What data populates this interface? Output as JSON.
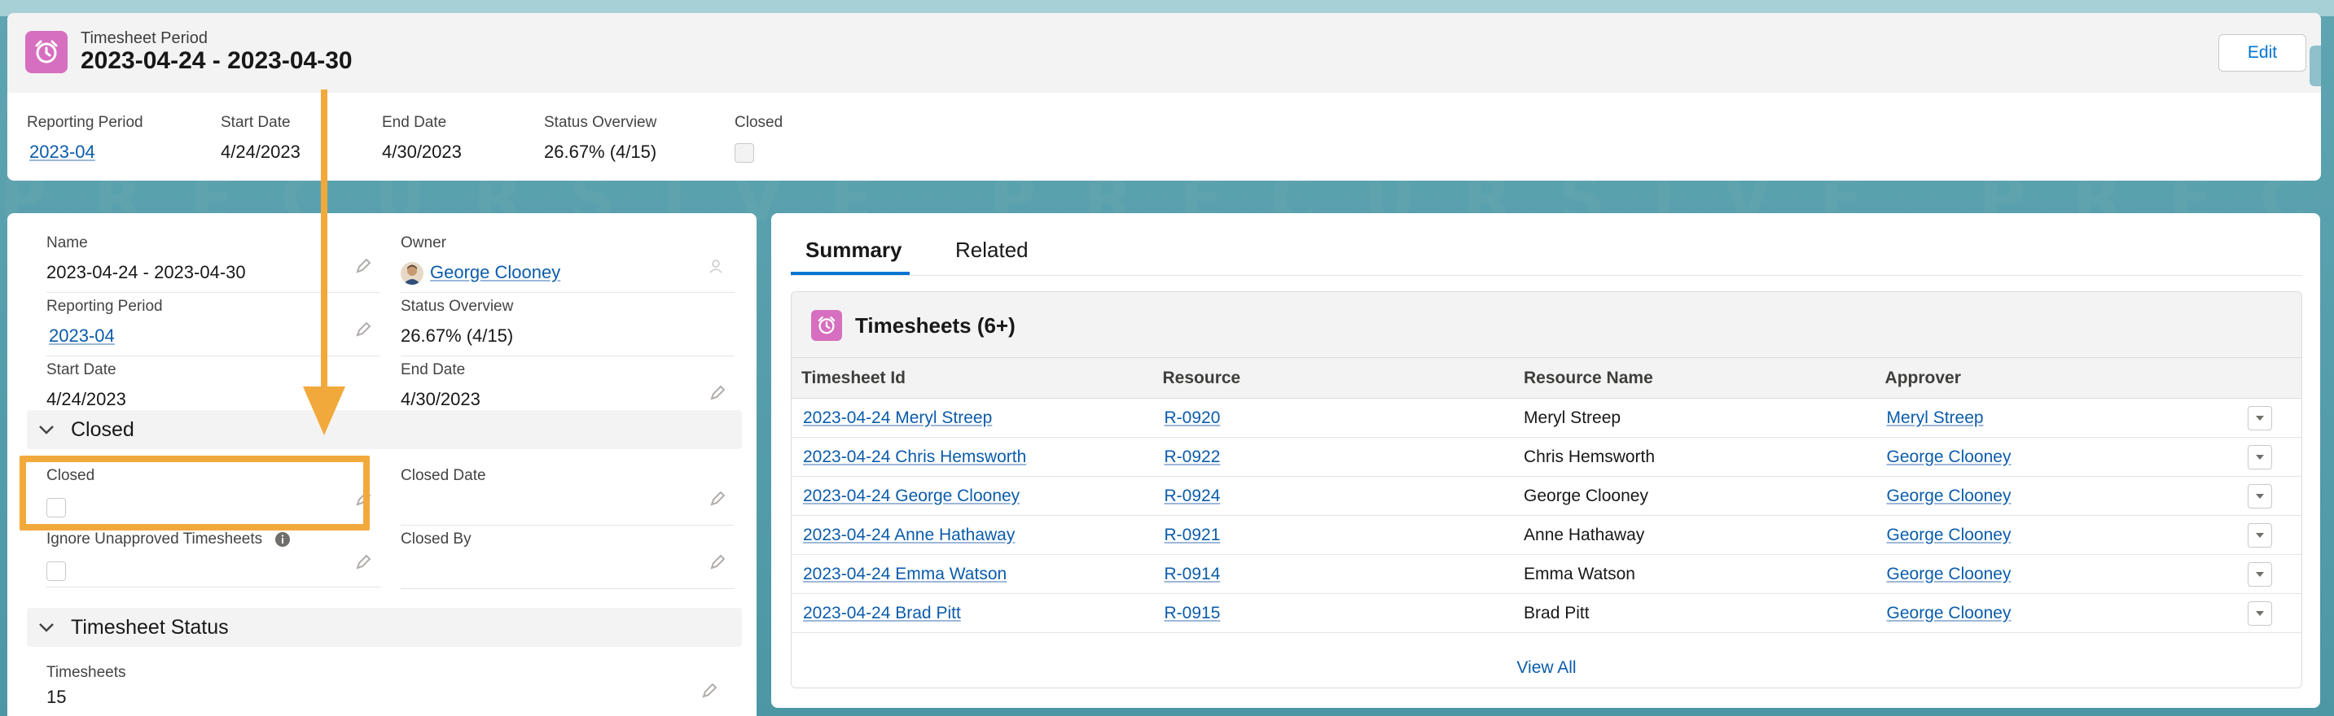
{
  "header": {
    "object_label": "Timesheet Period",
    "title": "2023-04-24 - 2023-04-30",
    "edit_label": "Edit",
    "highlights": [
      {
        "label": "Reporting Period",
        "value": "2023-04"
      },
      {
        "label": "Start Date",
        "value": "4/24/2023"
      },
      {
        "label": "End Date",
        "value": "4/30/2023"
      },
      {
        "label": "Status Overview",
        "value": "26.67% (4/15)"
      },
      {
        "label": "Closed",
        "value": ""
      }
    ]
  },
  "watermark": "PRECURSIVE PRECURSIVE PRECURSIVE",
  "details": {
    "name_label": "Name",
    "name_value": "2023-04-24 - 2023-04-30",
    "owner_label": "Owner",
    "owner_value": "George Clooney",
    "reporting_period_label": "Reporting Period",
    "reporting_period_value": "2023-04",
    "status_overview_label": "Status Overview",
    "status_overview_value": "26.67% (4/15)",
    "start_date_label": "Start Date",
    "start_date_value": "4/24/2023",
    "end_date_label": "End Date",
    "end_date_value": "4/30/2023",
    "closed_section": "Closed",
    "closed_label": "Closed",
    "closed_date_label": "Closed Date",
    "ignore_unapproved_label": "Ignore Unapproved Timesheets",
    "closed_by_label": "Closed By",
    "timesheet_status_section": "Timesheet Status",
    "timesheets_label": "Timesheets",
    "timesheets_value": "15"
  },
  "tabs": {
    "summary": "Summary",
    "related": "Related"
  },
  "related": {
    "title": "Timesheets (6+)",
    "columns": [
      "Timesheet Id",
      "Resource",
      "Resource Name",
      "Approver"
    ],
    "rows": [
      {
        "id": "2023-04-24 Meryl Streep",
        "resource": "R-0920",
        "name": "Meryl Streep",
        "approver": "Meryl Streep"
      },
      {
        "id": "2023-04-24 Chris Hemsworth",
        "resource": "R-0922",
        "name": "Chris Hemsworth",
        "approver": "George Clooney"
      },
      {
        "id": "2023-04-24 George Clooney",
        "resource": "R-0924",
        "name": "George Clooney",
        "approver": "George Clooney"
      },
      {
        "id": "2023-04-24 Anne Hathaway",
        "resource": "R-0921",
        "name": "Anne Hathaway",
        "approver": "George Clooney"
      },
      {
        "id": "2023-04-24 Emma Watson",
        "resource": "R-0914",
        "name": "Emma Watson",
        "approver": "George Clooney"
      },
      {
        "id": "2023-04-24 Brad Pitt",
        "resource": "R-0915",
        "name": "Brad Pitt",
        "approver": "George Clooney"
      }
    ],
    "view_all": "View All"
  },
  "colors": {
    "accent": "#0176d3",
    "object_icon": "#d66fbf",
    "highlight": "#f2a93b"
  }
}
